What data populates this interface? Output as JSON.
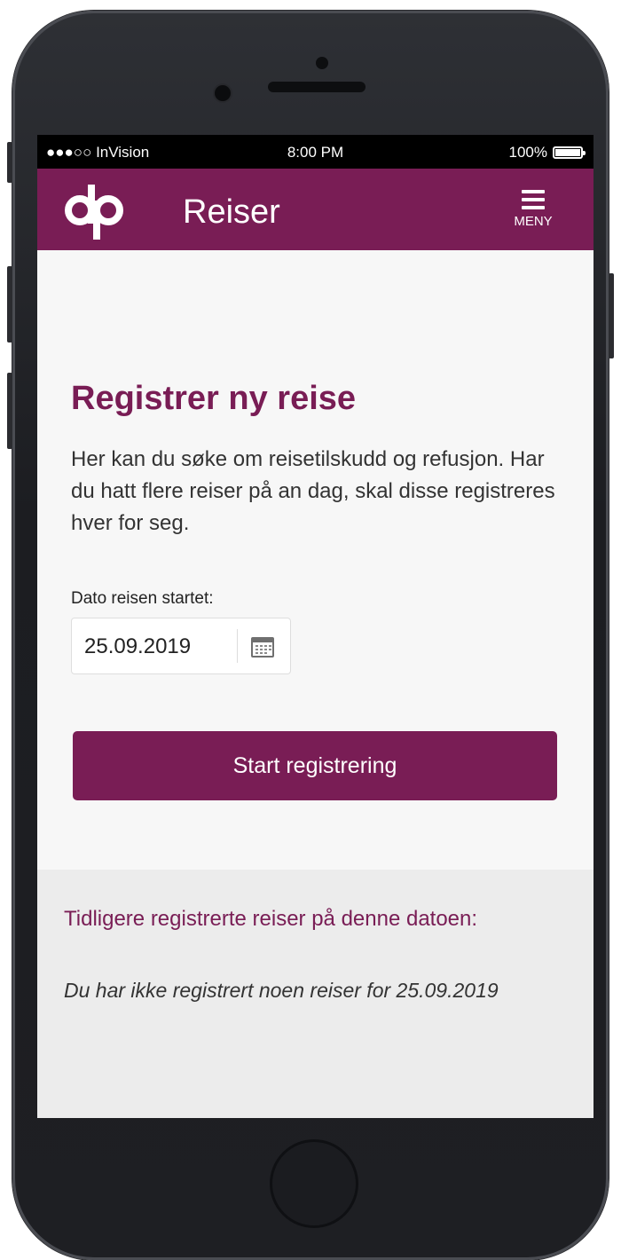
{
  "statusbar": {
    "carrier": "●●●○○ InVision",
    "time": "8:00 PM",
    "battery": "100%"
  },
  "appbar": {
    "logo_text": "dp",
    "title": "Reiser",
    "menu_label": "MENY"
  },
  "register": {
    "heading": "Registrer ny reise",
    "intro": "Her kan du søke om reisetilskudd og refusjon. Har du hatt flere reiser på an dag, skal disse registreres hver for seg.",
    "date_label": "Dato reisen startet:",
    "date_value": "25.09.2019",
    "start_button": "Start registrering"
  },
  "previous": {
    "title": "Tidligere registrerte reiser på denne datoen:",
    "empty_message": "Du har ikke registrert noen reiser for 25.09.2019"
  },
  "colors": {
    "brand": "#791d55",
    "page_bg": "#f7f7f7",
    "section_bg": "#ececec"
  }
}
